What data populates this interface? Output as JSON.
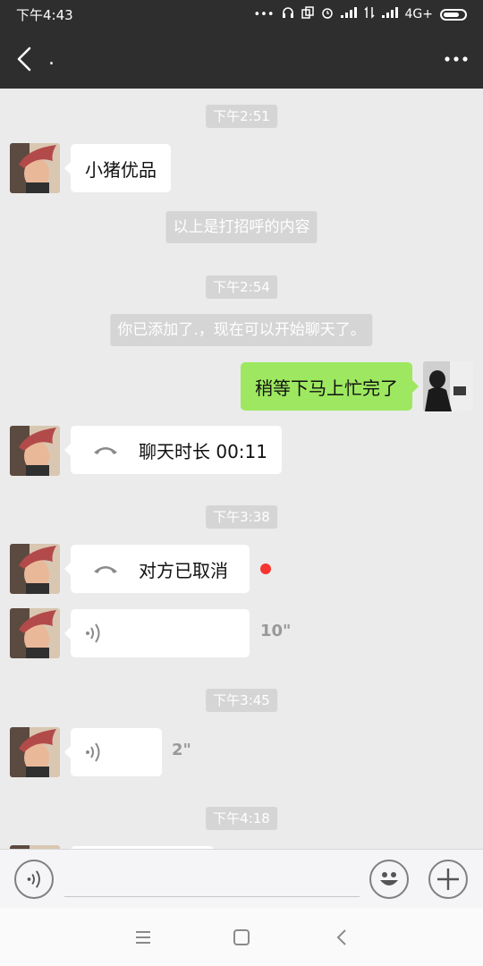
{
  "status": {
    "time": "下午4:43",
    "network": "4G+"
  },
  "header": {
    "title": ".",
    "back_icon": "chevron-left-icon",
    "more_icon": "more-dots-icon"
  },
  "messages": {
    "time1": "下午2:51",
    "msg1_text": "小猪优品",
    "sys1": "以上是打招呼的内容",
    "time2": "下午2:54",
    "sys2": "你已添加了.，现在可以开始聊天了。",
    "msg2_text": "稍等下马上忙完了",
    "msg3_call": "聊天时长 00:11",
    "time3": "下午3:38",
    "msg4_call": "对方已取消",
    "msg5_voice_duration": "10\"",
    "time4": "下午3:45",
    "msg6_voice_duration": "2\"",
    "time5": "下午4:18"
  },
  "colors": {
    "header_bg": "#2e2e2e",
    "chat_bg": "#ebebeb",
    "sent_bubble": "#9de860",
    "unread_dot": "#f43530"
  },
  "input_bar": {
    "voice_icon": "voice-input-icon",
    "emoji_icon": "emoji-icon",
    "plus_icon": "plus-icon"
  },
  "nav": {
    "menu_icon": "menu-icon",
    "home_icon": "home-square-icon",
    "back_icon": "nav-back-icon"
  }
}
